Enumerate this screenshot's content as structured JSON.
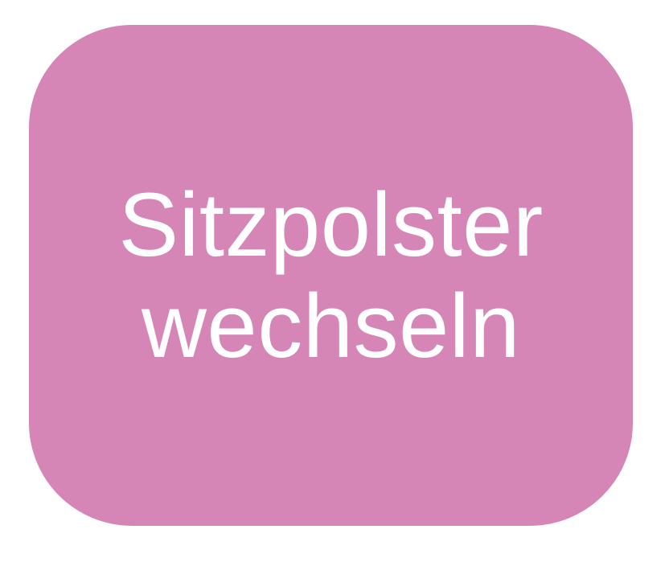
{
  "button": {
    "line1": "Sitzpolster",
    "line2": "wechseln"
  },
  "colors": {
    "tile_background": "#d686b6",
    "text": "#ffffff",
    "page_background": "#ffffff"
  }
}
